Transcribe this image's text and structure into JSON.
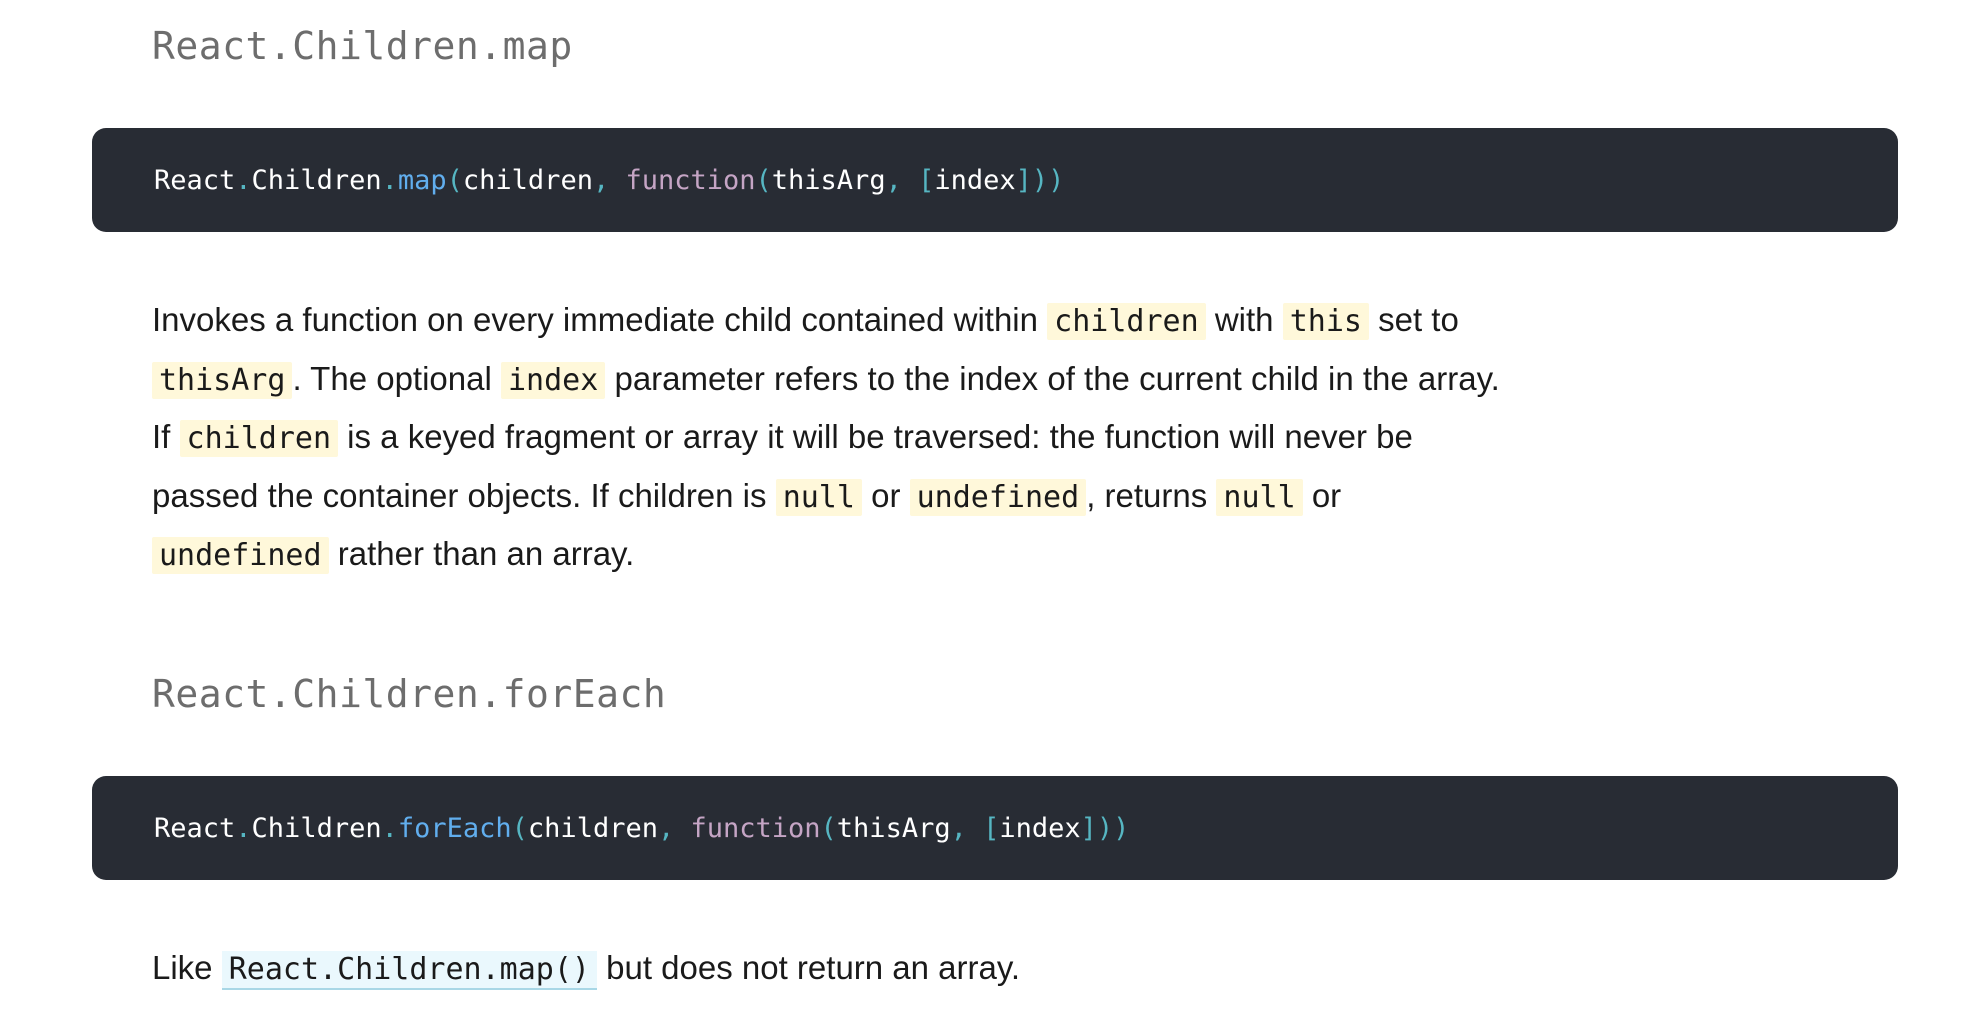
{
  "sections": [
    {
      "heading": "React.Children.map",
      "code": {
        "t0": "React",
        "t1": ".",
        "t2": "Children",
        "t3": ".",
        "t4": "map",
        "t5": "(",
        "t6": "children",
        "t7": ", ",
        "t8": "function",
        "t9": "(",
        "t10": "thisArg",
        "t11": ", ",
        "t12": "[",
        "t13": "index",
        "t14": "]))"
      },
      "description": {
        "p0": "Invokes a function on every immediate child contained within ",
        "c0": "children",
        "p1": " with ",
        "c1": "this",
        "p2": " set to",
        "c2": "thisArg",
        "p3": ". The optional ",
        "c3": "index",
        "p4": " parameter refers to the index of the current child in the array.",
        "p5": "If ",
        "c4": "children",
        "p6": " is a keyed fragment or array it will be traversed: the function will never be",
        "p7": "passed the container objects. If children is ",
        "c5": "null",
        "p8": " or ",
        "c6": "undefined",
        "p9": ", returns ",
        "c7": "null",
        "p10": " or",
        "c8": "undefined",
        "p11": " rather than an array."
      }
    },
    {
      "heading": "React.Children.forEach",
      "code": {
        "t0": "React",
        "t1": ".",
        "t2": "Children",
        "t3": ".",
        "t4": "forEach",
        "t5": "(",
        "t6": "children",
        "t7": ", ",
        "t8": "function",
        "t9": "(",
        "t10": "thisArg",
        "t11": ", ",
        "t12": "[",
        "t13": "index",
        "t14": "]))"
      },
      "description": {
        "p0": "Like ",
        "link": "React.Children.map()",
        "p1": " but does not return an array."
      }
    }
  ]
}
